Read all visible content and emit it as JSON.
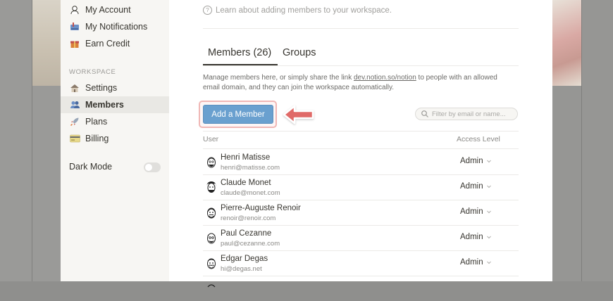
{
  "sidebar": {
    "items": [
      {
        "label": "My Account",
        "icon": "account-icon"
      },
      {
        "label": "My Notifications",
        "icon": "notifications-icon"
      },
      {
        "label": "Earn Credit",
        "icon": "gift-icon"
      }
    ],
    "workspace_heading": "WORKSPACE",
    "workspace_items": [
      {
        "label": "Settings",
        "icon": "house-icon"
      },
      {
        "label": "Members",
        "icon": "members-icon",
        "active": true
      },
      {
        "label": "Plans",
        "icon": "rocket-icon"
      },
      {
        "label": "Billing",
        "icon": "credit-card-icon"
      }
    ],
    "dark_mode_label": "Dark Mode",
    "dark_mode_on": false
  },
  "main": {
    "learn_text": "Learn about adding members to your workspace.",
    "tabs": [
      {
        "label": "Members (26)",
        "active": true
      },
      {
        "label": "Groups",
        "active": false
      }
    ],
    "description_before": "Manage members here, or simply share the link ",
    "description_link": "dev.notion.so/notion",
    "description_after": " to people with an allowed email domain, and they can join the workspace automatically.",
    "add_button_label": "Add a Member",
    "filter_placeholder": "Filter by email or name...",
    "columns": {
      "user": "User",
      "access": "Access Level"
    },
    "members": [
      {
        "name": "Henri Matisse",
        "email": "henri@matisse.com",
        "access": "Admin"
      },
      {
        "name": "Claude Monet",
        "email": "claude@monet.com",
        "access": "Admin"
      },
      {
        "name": "Pierre-Auguste Renoir",
        "email": "renoir@renoir.com",
        "access": "Admin"
      },
      {
        "name": "Paul Cezanne",
        "email": "paul@cezanne.com",
        "access": "Admin"
      },
      {
        "name": "Edgar Degas",
        "email": "hi@degas.net",
        "access": "Admin"
      }
    ]
  },
  "colors": {
    "accent_button": "#6aa0cf",
    "highlight": "#f0b7b5",
    "arrow": "#e06b67",
    "sidebar_bg": "#f7f6f3"
  }
}
